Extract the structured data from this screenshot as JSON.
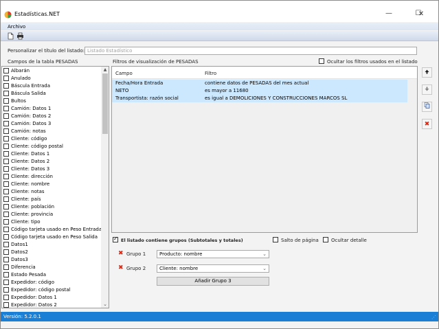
{
  "window": {
    "title": "Estadísticas.NET",
    "controls": {
      "minimize": "—",
      "maximize": "☐",
      "close": "✕"
    }
  },
  "menu": {
    "archivo": "Archivo"
  },
  "toolbar": {
    "icons": [
      "new-document-icon",
      "print-icon"
    ]
  },
  "title_section": {
    "label": "Personalizar el título del listado:",
    "placeholder": "Listado Estadístico"
  },
  "fields": {
    "label": "Campos de la tabla PESADAS",
    "items": [
      "Albarán",
      "Anulado",
      "Báscula Entrada",
      "Báscula Salida",
      "Bultos",
      "Camión: Datos 1",
      "Camión: Datos 2",
      "Camión: Datos 3",
      "Camión: notas",
      "Cliente: código",
      "Cliente: código postal",
      "Cliente: Datos 1",
      "Cliente: Datos 2",
      "Cliente: Datos 3",
      "Cliente: dirección",
      "Cliente: nombre",
      "Cliente: notas",
      "Cliente: país",
      "Cliente: población",
      "Cliente: provincia",
      "Cliente: tipo",
      "Código tarjeta usado en Peso Entrada",
      "Código tarjeta usado en Peso Salida",
      "Datos1",
      "Datos2",
      "Datos3",
      "Diferencia",
      "Estado Pesada",
      "Expedidor: código",
      "Expedidor: código postal",
      "Expedidor: Datos 1",
      "Expedidor: Datos 2"
    ]
  },
  "filters": {
    "label": "Filtros de visualización de PESADAS",
    "hide_label": "Ocultar los filtros usados en el listado",
    "columns": {
      "campo": "Campo",
      "filtro": "Filtro"
    },
    "rows": [
      {
        "campo": "Fecha/Hora Entrada",
        "filtro": "contiene datos de PESADAS del mes actual"
      },
      {
        "campo": "NETO",
        "filtro": "es mayor a 11680"
      },
      {
        "campo": "Transportista: razón social",
        "filtro": "es igual a DEMOLICIONES Y CONSTRUCCIONES MARCOS SL"
      }
    ]
  },
  "side_buttons": [
    "arrow-up-icon",
    "arrow-down-icon",
    "copy-icon",
    "delete-icon"
  ],
  "groups": {
    "contains_groups_label": "El listado contiene grupos (Subtotales y totales)",
    "page_break_label": "Salto de página",
    "hide_detail_label": "Ocultar detalle",
    "group1_label": "Grupo 1",
    "group1_value": "Producto: nombre",
    "group2_label": "Grupo 2",
    "group2_value": "Cliente: nombre",
    "add_button": "Añadir Grupo 3"
  },
  "status": {
    "version": "Versión: 5.2.0.1"
  },
  "colors": {
    "accent": "#1c7fd6",
    "selection": "#cce8ff",
    "delete": "#d62b16"
  }
}
